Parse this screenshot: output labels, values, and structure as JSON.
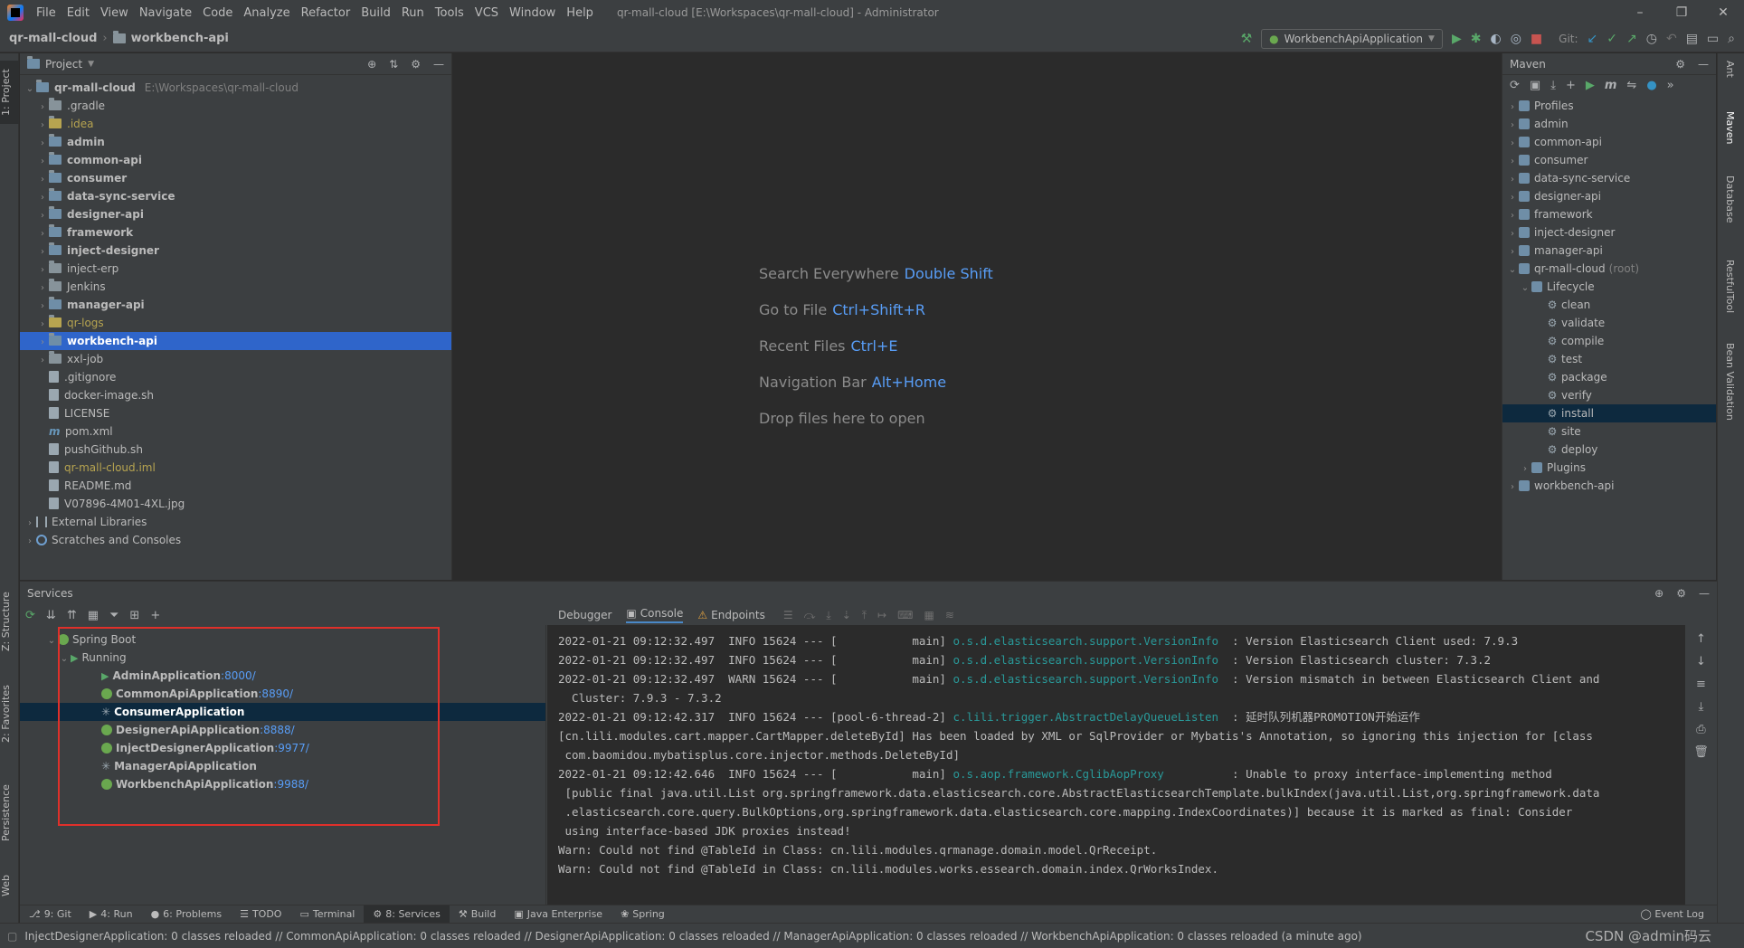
{
  "menubar": {
    "items": [
      "File",
      "Edit",
      "View",
      "Navigate",
      "Code",
      "Analyze",
      "Refactor",
      "Build",
      "Run",
      "Tools",
      "VCS",
      "Window",
      "Help"
    ],
    "title": "qr-mall-cloud [E:\\Workspaces\\qr-mall-cloud] - Administrator",
    "min": "–",
    "max": "❐",
    "close": "✕"
  },
  "navbar": {
    "project": "qr-mall-cloud",
    "module": "workbench-api",
    "run_config": "WorkbenchApiApplication",
    "git_label": "Git:"
  },
  "left_stripe": {
    "project_tab": "1: Project",
    "structure_tab": "Z: Structure",
    "favorites_tab": "2: Favorites",
    "persistence_tab": "Persistence",
    "web_tab": "Web"
  },
  "right_stripe": {
    "ant": "Ant",
    "maven": "Maven",
    "database": "Database",
    "resttool": "RestfulTool",
    "bean": "Bean Validation"
  },
  "project": {
    "header": "Project",
    "root": {
      "name": "qr-mall-cloud",
      "path": "E:\\Workspaces\\qr-mall-cloud"
    },
    "folders": [
      {
        "name": ".gradle",
        "style": "normal"
      },
      {
        "name": ".idea",
        "style": "yellow"
      },
      {
        "name": "admin",
        "style": "bold"
      },
      {
        "name": "common-api",
        "style": "bold"
      },
      {
        "name": "consumer",
        "style": "bold"
      },
      {
        "name": "data-sync-service",
        "style": "bold"
      },
      {
        "name": "designer-api",
        "style": "bold"
      },
      {
        "name": "framework",
        "style": "bold"
      },
      {
        "name": "inject-designer",
        "style": "bold"
      },
      {
        "name": "inject-erp",
        "style": "normal"
      },
      {
        "name": "Jenkins",
        "style": "normal"
      },
      {
        "name": "manager-api",
        "style": "bold"
      },
      {
        "name": "qr-logs",
        "style": "yellow"
      },
      {
        "name": "workbench-api",
        "style": "bold-selected"
      },
      {
        "name": "xxl-job",
        "style": "normal"
      }
    ],
    "files": [
      {
        "name": ".gitignore",
        "style": "normal",
        "icon": "file"
      },
      {
        "name": "docker-image.sh",
        "style": "normal",
        "icon": "file"
      },
      {
        "name": "LICENSE",
        "style": "normal",
        "icon": "file"
      },
      {
        "name": "pom.xml",
        "style": "normal",
        "icon": "maven"
      },
      {
        "name": "pushGithub.sh",
        "style": "normal",
        "icon": "file"
      },
      {
        "name": "qr-mall-cloud.iml",
        "style": "yellow",
        "icon": "file"
      },
      {
        "name": "README.md",
        "style": "normal",
        "icon": "file"
      },
      {
        "name": "V07896-4M01-4XL.jpg",
        "style": "normal",
        "icon": "file"
      }
    ],
    "external_libraries": "External Libraries",
    "scratches": "Scratches and Consoles"
  },
  "editor": {
    "hints": [
      {
        "label": "Search Everywhere",
        "key": "Double Shift"
      },
      {
        "label": "Go to File",
        "key": "Ctrl+Shift+R"
      },
      {
        "label": "Recent Files",
        "key": "Ctrl+E"
      },
      {
        "label": "Navigation Bar",
        "key": "Alt+Home"
      },
      {
        "label": "Drop files here to open",
        "key": ""
      }
    ]
  },
  "maven": {
    "header": "Maven",
    "top_modules": [
      "Profiles",
      "admin",
      "common-api",
      "consumer",
      "data-sync-service",
      "designer-api",
      "framework",
      "inject-designer",
      "manager-api"
    ],
    "root_module": "qr-mall-cloud",
    "root_suffix": "(root)",
    "lifecycle": "Lifecycle",
    "phases": [
      "clean",
      "validate",
      "compile",
      "test",
      "package",
      "verify",
      "install",
      "site",
      "deploy"
    ],
    "selected_phase": "install",
    "plugins": "Plugins",
    "last_module": "workbench-api"
  },
  "services": {
    "header": "Services",
    "group": "Spring Boot",
    "running": "Running",
    "apps": [
      {
        "name": "AdminApplication",
        "port": ":8000/",
        "icon": "play"
      },
      {
        "name": "CommonApiApplication",
        "port": ":8890/",
        "icon": "boot"
      },
      {
        "name": "ConsumerApplication",
        "port": "",
        "icon": "spin"
      },
      {
        "name": "DesignerApiApplication",
        "port": ":8888/",
        "icon": "boot"
      },
      {
        "name": "InjectDesignerApplication",
        "port": ":9977/",
        "icon": "boot"
      },
      {
        "name": "ManagerApiApplication",
        "port": "",
        "icon": "spin"
      },
      {
        "name": "WorkbenchApiApplication",
        "port": ":9988/",
        "icon": "boot"
      }
    ],
    "selected_app": "ConsumerApplication"
  },
  "console": {
    "tabs": [
      "Debugger",
      "Console",
      "Endpoints"
    ],
    "active_tab": "Console",
    "lines": [
      {
        "pre": "2022-01-21 09:12:32.497  INFO 15624 --- [           main] ",
        "cls": "o.s.d.elasticsearch.support.VersionInfo",
        "post": "  : Version Elasticsearch Client used: 7.9.3"
      },
      {
        "pre": "2022-01-21 09:12:32.497  INFO 15624 --- [           main] ",
        "cls": "o.s.d.elasticsearch.support.VersionInfo",
        "post": "  : Version Elasticsearch cluster: 7.3.2"
      },
      {
        "pre": "2022-01-21 09:12:32.497  WARN 15624 --- [           main] ",
        "cls": "o.s.d.elasticsearch.support.VersionInfo",
        "post": "  : Version mismatch in between Elasticsearch Client and"
      },
      {
        "pre": "  Cluster: 7.9.3 - 7.3.2",
        "cls": "",
        "post": ""
      },
      {
        "pre": "2022-01-21 09:12:42.317  INFO 15624 --- [pool-6-thread-2] ",
        "cls": "c.lili.trigger.AbstractDelayQueueListen",
        "post": "  : 延时队列机器PROMOTION开始运作"
      },
      {
        "pre": "[cn.lili.modules.cart.mapper.CartMapper.deleteById] Has been loaded by XML or SqlProvider or Mybatis's Annotation, so ignoring this injection for [class",
        "cls": "",
        "post": ""
      },
      {
        "pre": " com.baomidou.mybatisplus.core.injector.methods.DeleteById]",
        "cls": "",
        "post": ""
      },
      {
        "pre": "2022-01-21 09:12:42.646  INFO 15624 --- [           main] ",
        "cls": "o.s.aop.framework.CglibAopProxy",
        "post": "          : Unable to proxy interface-implementing method"
      },
      {
        "pre": " [public final java.util.List org.springframework.data.elasticsearch.core.AbstractElasticsearchTemplate.bulkIndex(java.util.List,org.springframework.data",
        "cls": "",
        "post": ""
      },
      {
        "pre": " .elasticsearch.core.query.BulkOptions,org.springframework.data.elasticsearch.core.mapping.IndexCoordinates)] because it is marked as final: Consider",
        "cls": "",
        "post": ""
      },
      {
        "pre": " using interface-based JDK proxies instead!",
        "cls": "",
        "post": ""
      },
      {
        "pre": "Warn: Could not find @TableId in Class: cn.lili.modules.qrmanage.domain.model.QrReceipt.",
        "cls": "",
        "post": ""
      },
      {
        "pre": "Warn: Could not find @TableId in Class: cn.lili.modules.works.essearch.domain.index.QrWorksIndex.",
        "cls": "",
        "post": ""
      }
    ]
  },
  "tooltabs": {
    "items": [
      {
        "label": "9: Git",
        "icon": "⎇"
      },
      {
        "label": "4: Run",
        "icon": "▶"
      },
      {
        "label": "6: Problems",
        "icon": "●"
      },
      {
        "label": "TODO",
        "icon": "☰"
      },
      {
        "label": "Terminal",
        "icon": "▭"
      },
      {
        "label": "8: Services",
        "icon": "⚙",
        "active": true
      },
      {
        "label": "Build",
        "icon": "⚒"
      },
      {
        "label": "Java Enterprise",
        "icon": "▣"
      },
      {
        "label": "Spring",
        "icon": "❀"
      }
    ],
    "event_log": "Event Log"
  },
  "statusbar": {
    "text": "InjectDesignerApplication: 0 classes reloaded // CommonApiApplication: 0 classes reloaded // DesignerApiApplication: 0 classes reloaded // ManagerApiApplication: 0 classes reloaded // WorkbenchApiApplication: 0 classes reloaded (a minute ago)",
    "watermark": "CSDN @admin码云"
  },
  "colors": {
    "accent": "#589df6",
    "selection": "#2f65ca",
    "highlight_box": "#e0302a"
  }
}
